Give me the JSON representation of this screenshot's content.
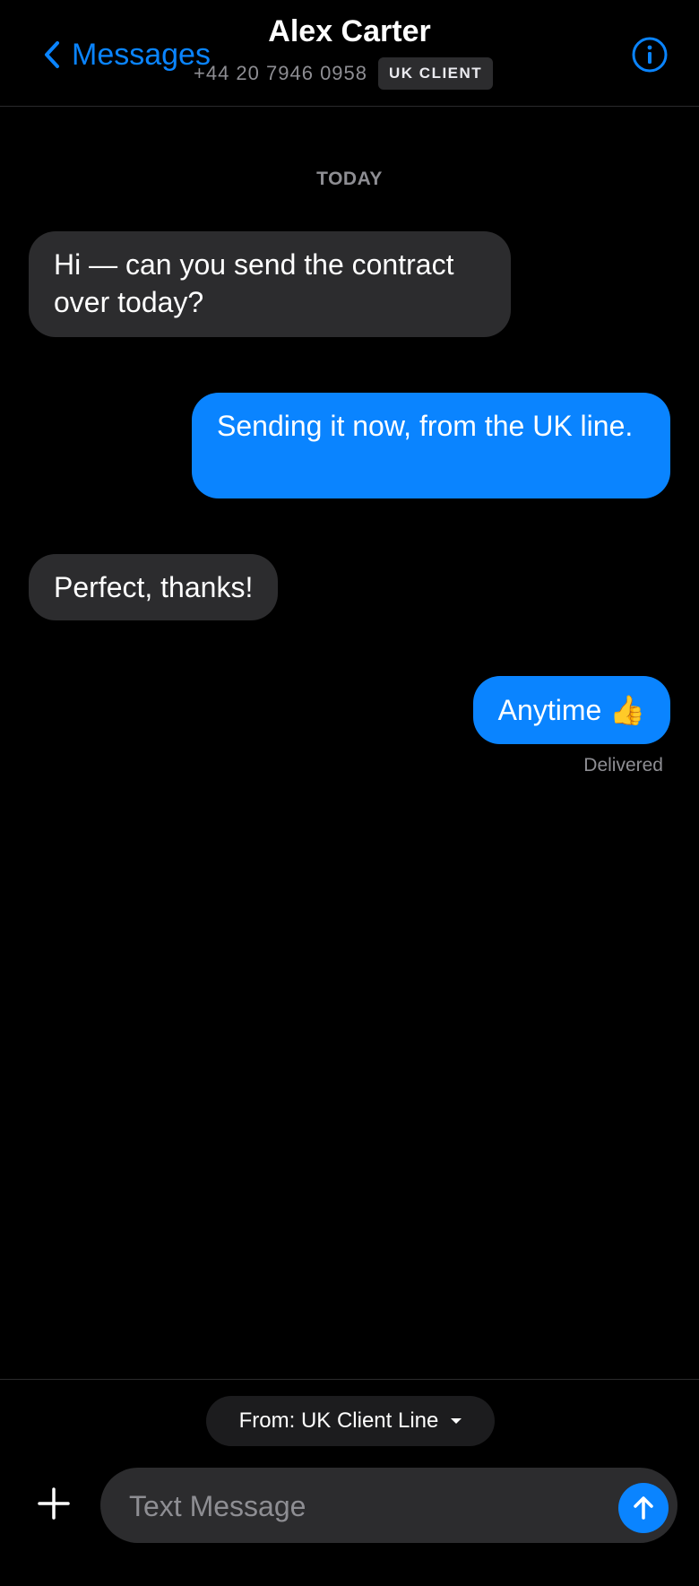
{
  "header": {
    "back_label": "Messages",
    "contact_name": "Alex Carter",
    "phone": "+44 20 7946 0958",
    "badge": "UK CLIENT"
  },
  "thread": {
    "day_label": "TODAY",
    "messages": [
      {
        "direction": "incoming",
        "text": "Hi — can you send the contract over today?"
      },
      {
        "direction": "outgoing",
        "text": "Sending it now, from the UK line."
      },
      {
        "direction": "incoming",
        "text": "Perfect, thanks!"
      },
      {
        "direction": "outgoing",
        "text": "Anytime 👍"
      }
    ],
    "status": "Delivered"
  },
  "composer": {
    "from_label": "From: UK Client Line",
    "placeholder": "Text Message"
  },
  "colors": {
    "accent": "#0a84ff",
    "incoming_bubble": "#2c2c2e",
    "background": "#000000"
  },
  "icons": {
    "back": "chevron-left-icon",
    "info": "info-circle-icon",
    "add": "plus-icon",
    "send": "arrow-up-icon",
    "from_dropdown": "caret-down-icon"
  }
}
